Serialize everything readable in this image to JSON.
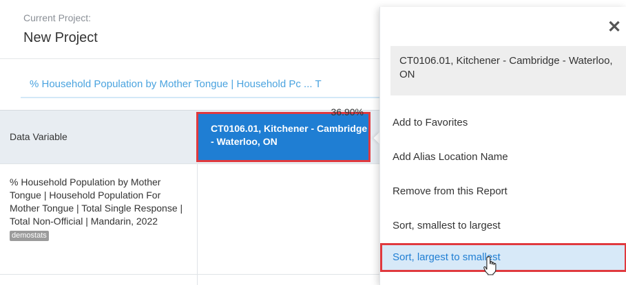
{
  "project": {
    "label": "Current Project:",
    "name": "New Project"
  },
  "variable_tab": {
    "text": "% Household Population by Mother Tongue | Household Pc ... T"
  },
  "table": {
    "header_variable": "Data Variable",
    "header_location": "CT0106.01, Kitchener - Cambridge - Waterloo, ON",
    "row": {
      "description": "% Household Population by Mother Tongue | Household Population For Mother Tongue | Total Single Response | Total Non-Official | Mandarin, 2022",
      "source_tag": "demostats",
      "value": "36.90%"
    }
  },
  "popup": {
    "close_symbol": "✕",
    "location": "CT0106.01, Kitchener - Cambridge - Waterloo, ON",
    "menu": [
      {
        "label": "Add to Favorites"
      },
      {
        "label": "Add Alias Location Name"
      },
      {
        "label": "Remove from this Report"
      },
      {
        "label": "Sort, smallest to largest"
      },
      {
        "label": "Sort, largest to smallest"
      }
    ]
  },
  "colors": {
    "accent": "#1f7ed3",
    "highlight_border": "#e0393e",
    "link": "#4aa3df",
    "header_bg": "#e8edf2",
    "menu_hover": "#d7e9f8"
  },
  "icons": {
    "close": "close-icon",
    "cursor": "hand-pointer-icon"
  }
}
